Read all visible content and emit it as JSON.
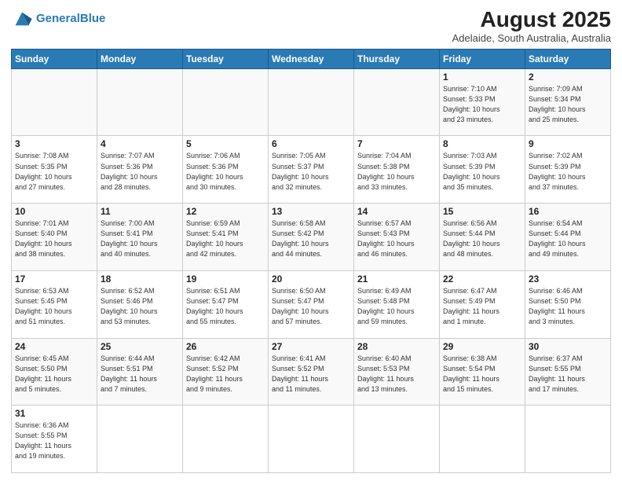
{
  "logo": {
    "text_general": "General",
    "text_blue": "Blue"
  },
  "title": "August 2025",
  "subtitle": "Adelaide, South Australia, Australia",
  "weekdays": [
    "Sunday",
    "Monday",
    "Tuesday",
    "Wednesday",
    "Thursday",
    "Friday",
    "Saturday"
  ],
  "weeks": [
    [
      {
        "day": "",
        "info": ""
      },
      {
        "day": "",
        "info": ""
      },
      {
        "day": "",
        "info": ""
      },
      {
        "day": "",
        "info": ""
      },
      {
        "day": "",
        "info": ""
      },
      {
        "day": "1",
        "info": "Sunrise: 7:10 AM\nSunset: 5:33 PM\nDaylight: 10 hours\nand 23 minutes."
      },
      {
        "day": "2",
        "info": "Sunrise: 7:09 AM\nSunset: 5:34 PM\nDaylight: 10 hours\nand 25 minutes."
      }
    ],
    [
      {
        "day": "3",
        "info": "Sunrise: 7:08 AM\nSunset: 5:35 PM\nDaylight: 10 hours\nand 27 minutes."
      },
      {
        "day": "4",
        "info": "Sunrise: 7:07 AM\nSunset: 5:36 PM\nDaylight: 10 hours\nand 28 minutes."
      },
      {
        "day": "5",
        "info": "Sunrise: 7:06 AM\nSunset: 5:36 PM\nDaylight: 10 hours\nand 30 minutes."
      },
      {
        "day": "6",
        "info": "Sunrise: 7:05 AM\nSunset: 5:37 PM\nDaylight: 10 hours\nand 32 minutes."
      },
      {
        "day": "7",
        "info": "Sunrise: 7:04 AM\nSunset: 5:38 PM\nDaylight: 10 hours\nand 33 minutes."
      },
      {
        "day": "8",
        "info": "Sunrise: 7:03 AM\nSunset: 5:39 PM\nDaylight: 10 hours\nand 35 minutes."
      },
      {
        "day": "9",
        "info": "Sunrise: 7:02 AM\nSunset: 5:39 PM\nDaylight: 10 hours\nand 37 minutes."
      }
    ],
    [
      {
        "day": "10",
        "info": "Sunrise: 7:01 AM\nSunset: 5:40 PM\nDaylight: 10 hours\nand 38 minutes."
      },
      {
        "day": "11",
        "info": "Sunrise: 7:00 AM\nSunset: 5:41 PM\nDaylight: 10 hours\nand 40 minutes."
      },
      {
        "day": "12",
        "info": "Sunrise: 6:59 AM\nSunset: 5:41 PM\nDaylight: 10 hours\nand 42 minutes."
      },
      {
        "day": "13",
        "info": "Sunrise: 6:58 AM\nSunset: 5:42 PM\nDaylight: 10 hours\nand 44 minutes."
      },
      {
        "day": "14",
        "info": "Sunrise: 6:57 AM\nSunset: 5:43 PM\nDaylight: 10 hours\nand 46 minutes."
      },
      {
        "day": "15",
        "info": "Sunrise: 6:56 AM\nSunset: 5:44 PM\nDaylight: 10 hours\nand 48 minutes."
      },
      {
        "day": "16",
        "info": "Sunrise: 6:54 AM\nSunset: 5:44 PM\nDaylight: 10 hours\nand 49 minutes."
      }
    ],
    [
      {
        "day": "17",
        "info": "Sunrise: 6:53 AM\nSunset: 5:45 PM\nDaylight: 10 hours\nand 51 minutes."
      },
      {
        "day": "18",
        "info": "Sunrise: 6:52 AM\nSunset: 5:46 PM\nDaylight: 10 hours\nand 53 minutes."
      },
      {
        "day": "19",
        "info": "Sunrise: 6:51 AM\nSunset: 5:47 PM\nDaylight: 10 hours\nand 55 minutes."
      },
      {
        "day": "20",
        "info": "Sunrise: 6:50 AM\nSunset: 5:47 PM\nDaylight: 10 hours\nand 57 minutes."
      },
      {
        "day": "21",
        "info": "Sunrise: 6:49 AM\nSunset: 5:48 PM\nDaylight: 10 hours\nand 59 minutes."
      },
      {
        "day": "22",
        "info": "Sunrise: 6:47 AM\nSunset: 5:49 PM\nDaylight: 11 hours\nand 1 minute."
      },
      {
        "day": "23",
        "info": "Sunrise: 6:46 AM\nSunset: 5:50 PM\nDaylight: 11 hours\nand 3 minutes."
      }
    ],
    [
      {
        "day": "24",
        "info": "Sunrise: 6:45 AM\nSunset: 5:50 PM\nDaylight: 11 hours\nand 5 minutes."
      },
      {
        "day": "25",
        "info": "Sunrise: 6:44 AM\nSunset: 5:51 PM\nDaylight: 11 hours\nand 7 minutes."
      },
      {
        "day": "26",
        "info": "Sunrise: 6:42 AM\nSunset: 5:52 PM\nDaylight: 11 hours\nand 9 minutes."
      },
      {
        "day": "27",
        "info": "Sunrise: 6:41 AM\nSunset: 5:52 PM\nDaylight: 11 hours\nand 11 minutes."
      },
      {
        "day": "28",
        "info": "Sunrise: 6:40 AM\nSunset: 5:53 PM\nDaylight: 11 hours\nand 13 minutes."
      },
      {
        "day": "29",
        "info": "Sunrise: 6:38 AM\nSunset: 5:54 PM\nDaylight: 11 hours\nand 15 minutes."
      },
      {
        "day": "30",
        "info": "Sunrise: 6:37 AM\nSunset: 5:55 PM\nDaylight: 11 hours\nand 17 minutes."
      }
    ],
    [
      {
        "day": "31",
        "info": "Sunrise: 6:36 AM\nSunset: 5:55 PM\nDaylight: 11 hours\nand 19 minutes."
      },
      {
        "day": "",
        "info": ""
      },
      {
        "day": "",
        "info": ""
      },
      {
        "day": "",
        "info": ""
      },
      {
        "day": "",
        "info": ""
      },
      {
        "day": "",
        "info": ""
      },
      {
        "day": "",
        "info": ""
      }
    ]
  ]
}
